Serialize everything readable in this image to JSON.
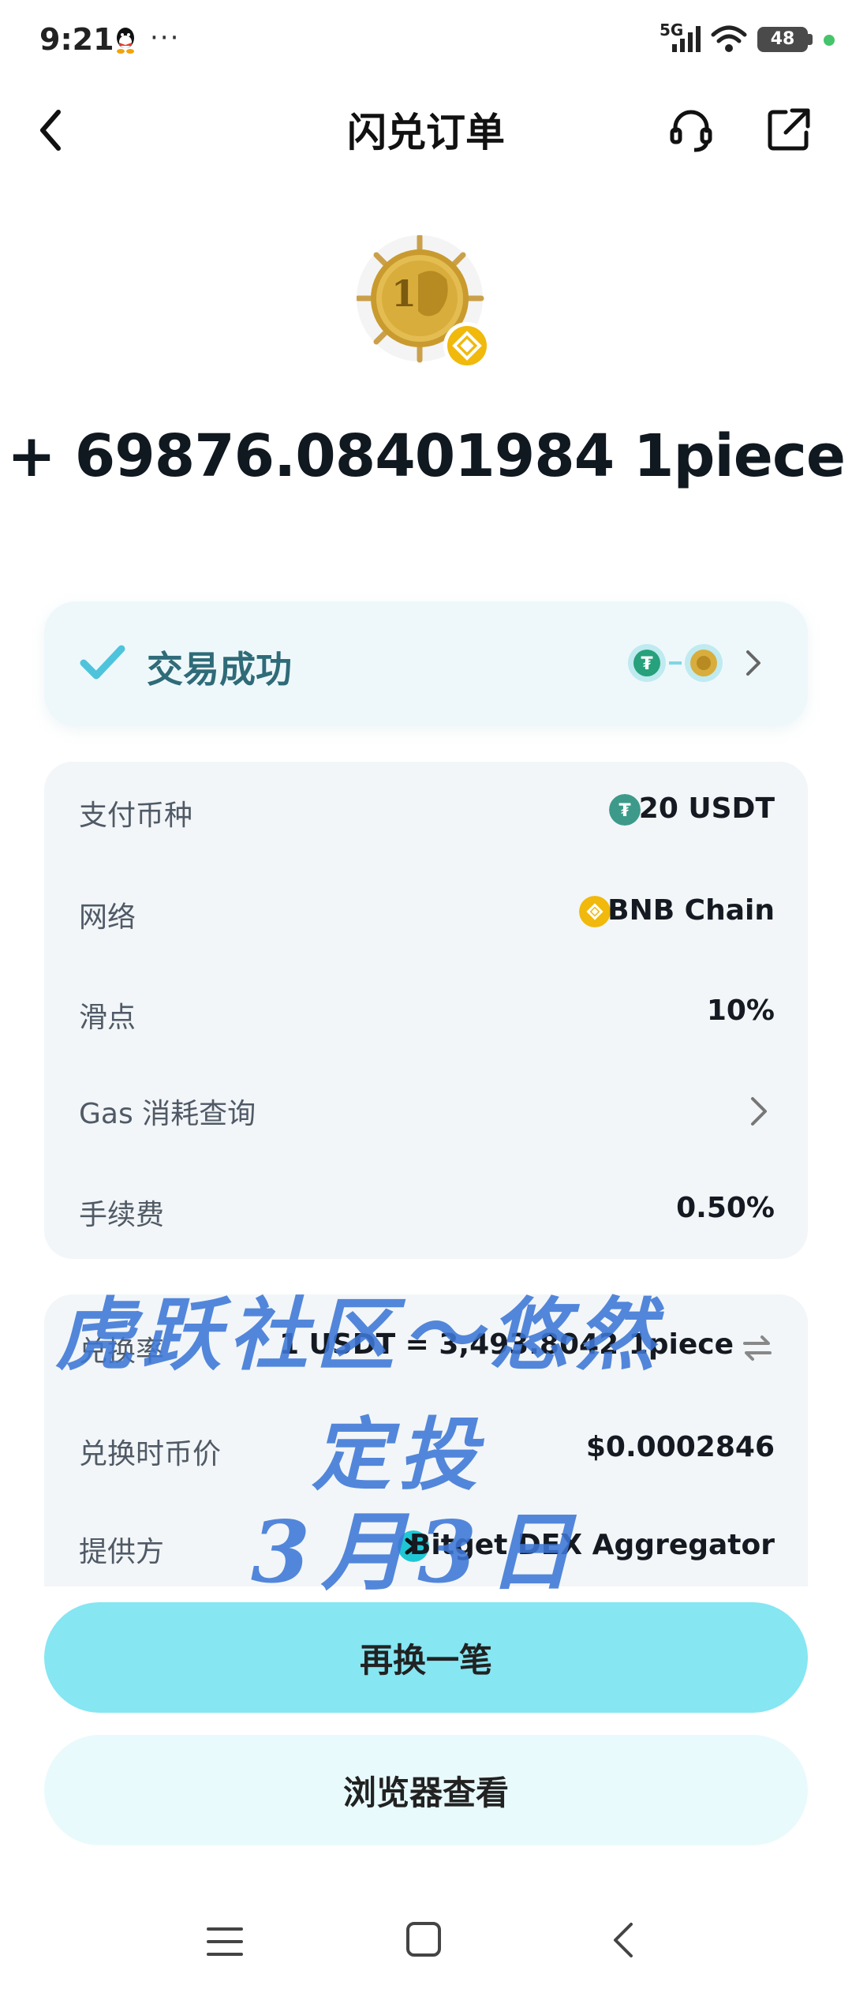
{
  "status_bar": {
    "time": "9:21",
    "more": "···",
    "network": "5G",
    "battery": "48"
  },
  "header": {
    "title": "闪兑订单",
    "icons": [
      "back-icon",
      "headset-icon",
      "share-icon"
    ]
  },
  "order": {
    "amount": "+ 69876.08401984 1piece",
    "status": "交易成功"
  },
  "details": [
    {
      "label": "支付币种",
      "value": "20 USDT",
      "icon": "usdt-icon"
    },
    {
      "label": "网络",
      "value": "BNB Chain",
      "icon": "bnb-icon"
    },
    {
      "label": "滑点",
      "value": "10%"
    },
    {
      "label": "Gas 消耗查询",
      "icon": "chevron-right-icon"
    },
    {
      "label": "手续费",
      "value": "0.50%"
    }
  ],
  "rate": [
    {
      "label": "兑换率",
      "value": "1 USDT = 3,493.8042 1piece",
      "icon": "swap-icon"
    },
    {
      "label": "兑换时币价",
      "value": "$0.0002846"
    },
    {
      "label": "提供方",
      "value": "Bitget DEX Aggregator",
      "icon": "bitget-icon"
    }
  ],
  "buttons": {
    "primary": "再换一笔",
    "secondary": "浏览器查看"
  },
  "watermark": {
    "line1": "虎跃社区～悠然",
    "line2": "定投",
    "line3": "3月3日"
  },
  "colors": {
    "accent": "#86e6f2",
    "status_text": "#2f6b78",
    "check": "#4ec3dc",
    "watermark": "#3d77d6"
  }
}
